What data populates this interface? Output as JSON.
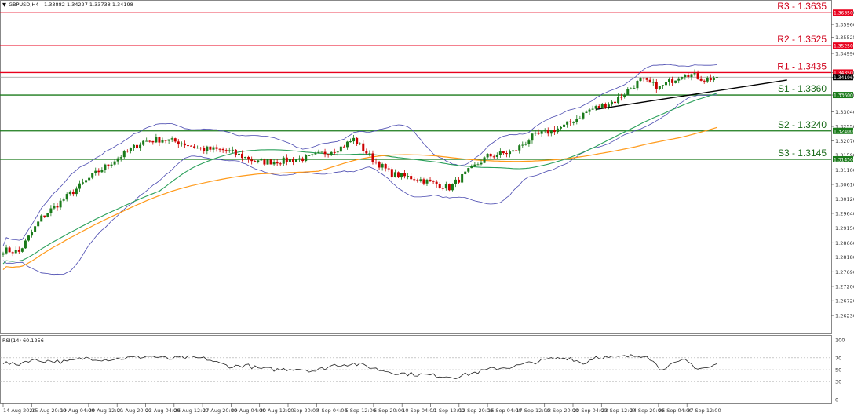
{
  "header": {
    "symbol": "GBPUSD,H4",
    "ohlc": "1.33882 1.34227 1.33738 1.34198"
  },
  "rsi_header": "RSI(14) 60.1256",
  "colors": {
    "bull": "#1a7a1a",
    "bear": "#cc0000",
    "resistance": "#e8001c",
    "support": "#1a7a1a",
    "ma_fast": "#2aa05a",
    "ma_slow": "#ff9a1a",
    "bollinger": "#4a4ab0",
    "trendline": "#000000",
    "rsi_line": "#222222"
  },
  "chart_data": {
    "type": "candlestick",
    "title": "",
    "ylim": [
      1.2565,
      1.3675
    ],
    "y_ticks": [
      "1.36350",
      "1.35960",
      "1.35525",
      "1.34990",
      "1.34350",
      "1.34196",
      "1.33600",
      "1.33040",
      "1.32550",
      "1.32070",
      "1.31590",
      "1.31100",
      "1.30610",
      "1.30120",
      "1.29640",
      "1.29150",
      "1.28660",
      "1.28180",
      "1.27690",
      "1.27200",
      "1.26720",
      "1.26230"
    ],
    "x_labels": [
      "14 Aug 2024",
      "15 Aug 20:00",
      "19 Aug 04:00",
      "20 Aug 12:00",
      "21 Aug 20:00",
      "23 Aug 04:00",
      "26 Aug 12:00",
      "27 Aug 20:00",
      "29 Aug 04:00",
      "30 Aug 12:00",
      "2 Sep 20:00",
      "4 Sep 04:00",
      "5 Sep 12:00",
      "6 Sep 20:00",
      "10 Sep 04:00",
      "11 Sep 12:00",
      "12 Sep 20:00",
      "16 Sep 04:00",
      "17 Sep 12:00",
      "18 Sep 20:00",
      "20 Sep 04:00",
      "23 Sep 12:00",
      "24 Sep 20:00",
      "26 Sep 04:00",
      "27 Sep 12:00"
    ],
    "anchors": [
      [
        0,
        1.2842
      ],
      [
        5,
        1.2835
      ],
      [
        12,
        1.295
      ],
      [
        20,
        1.302
      ],
      [
        28,
        1.309
      ],
      [
        36,
        1.315
      ],
      [
        44,
        1.3205
      ],
      [
        50,
        1.3212
      ],
      [
        56,
        1.32
      ],
      [
        62,
        1.318
      ],
      [
        70,
        1.3175
      ],
      [
        80,
        1.3135
      ],
      [
        88,
        1.314
      ],
      [
        96,
        1.315
      ],
      [
        106,
        1.3185
      ],
      [
        110,
        1.3212
      ],
      [
        116,
        1.3145
      ],
      [
        122,
        1.3095
      ],
      [
        130,
        1.308
      ],
      [
        140,
        1.305
      ],
      [
        146,
        1.3105
      ],
      [
        152,
        1.3155
      ],
      [
        160,
        1.317
      ],
      [
        166,
        1.322
      ],
      [
        176,
        1.3255
      ],
      [
        184,
        1.331
      ],
      [
        192,
        1.334
      ],
      [
        200,
        1.341
      ],
      [
        206,
        1.3385
      ],
      [
        210,
        1.341
      ],
      [
        214,
        1.3435
      ],
      [
        220,
        1.3412
      ],
      [
        224,
        1.3419
      ]
    ],
    "current_price": 1.34198,
    "levels": [
      {
        "label": "R3 - 1.3635",
        "value": 1.3635,
        "tag": "1.36350",
        "type": "resistance"
      },
      {
        "label": "R2 - 1.3525",
        "value": 1.3525,
        "tag": "1.35250",
        "type": "resistance"
      },
      {
        "label": "R1 - 1.3435",
        "value": 1.3435,
        "tag": "1.34350",
        "type": "resistance"
      },
      {
        "label": "S1 - 1.3360",
        "value": 1.336,
        "tag": "1.33600",
        "type": "support"
      },
      {
        "label": "S2 - 1.3240",
        "value": 1.324,
        "tag": "1.32400",
        "type": "support"
      },
      {
        "label": "S3 - 1.3145",
        "value": 1.3145,
        "tag": "1.31450",
        "type": "support"
      }
    ],
    "current_tag": "1.34196",
    "trendline": {
      "from": [
        186,
        1.3312
      ],
      "to": [
        246,
        1.341
      ]
    },
    "rsi": {
      "ylim": [
        0,
        100
      ],
      "ticks": [
        "100",
        "70",
        "50",
        "30",
        "0"
      ],
      "anchors": [
        [
          0,
          62
        ],
        [
          4,
          58
        ],
        [
          8,
          66
        ],
        [
          14,
          65
        ],
        [
          20,
          63
        ],
        [
          26,
          70
        ],
        [
          32,
          67
        ],
        [
          40,
          70
        ],
        [
          46,
          73
        ],
        [
          52,
          68
        ],
        [
          56,
          70
        ],
        [
          60,
          70
        ],
        [
          64,
          68
        ],
        [
          68,
          60
        ],
        [
          72,
          55
        ],
        [
          76,
          58
        ],
        [
          80,
          52
        ],
        [
          86,
          50
        ],
        [
          92,
          52
        ],
        [
          98,
          48
        ],
        [
          104,
          58
        ],
        [
          110,
          60
        ],
        [
          114,
          56
        ],
        [
          118,
          50
        ],
        [
          124,
          44
        ],
        [
          130,
          42
        ],
        [
          136,
          40
        ],
        [
          142,
          38
        ],
        [
          148,
          45
        ],
        [
          154,
          52
        ],
        [
          160,
          55
        ],
        [
          166,
          62
        ],
        [
          172,
          68
        ],
        [
          178,
          70
        ],
        [
          182,
          60
        ],
        [
          186,
          72
        ],
        [
          190,
          70
        ],
        [
          196,
          72
        ],
        [
          202,
          75
        ],
        [
          206,
          52
        ],
        [
          210,
          58
        ],
        [
          214,
          66
        ],
        [
          218,
          52
        ],
        [
          222,
          54
        ],
        [
          224,
          60
        ]
      ],
      "value": 60.1256
    }
  }
}
